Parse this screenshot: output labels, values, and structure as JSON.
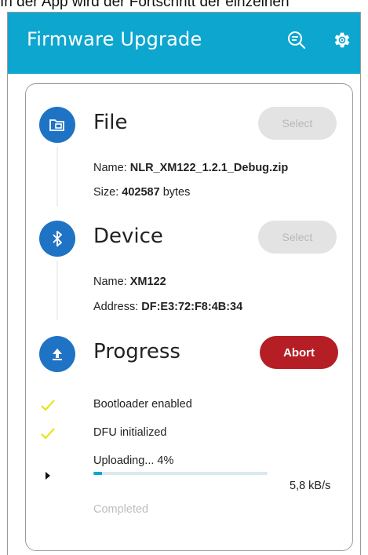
{
  "caption": "In der App wird der Fortschritt der einzelnen",
  "appbar": {
    "title": "Firmware Upgrade",
    "bg_color": "#0da6cf",
    "actions": [
      {
        "icon": "search-list-icon"
      },
      {
        "icon": "gear-icon"
      }
    ]
  },
  "sections": {
    "file": {
      "title": "File",
      "icon": "folder-icon",
      "button": "Select",
      "name_label": "Name:",
      "name_value": "NLR_XM122_1.2.1_Debug.zip",
      "size_label": "Size:",
      "size_value": "402587",
      "size_unit": "bytes"
    },
    "device": {
      "title": "Device",
      "icon": "bluetooth-icon",
      "button": "Select",
      "name_label": "Name:",
      "name_value": "XM122",
      "address_label": "Address:",
      "address_value": "DF:E3:72:F8:4B:34"
    },
    "progress": {
      "title": "Progress",
      "icon": "upload-icon",
      "abort_button": "Abort",
      "abort_color": "#b51e24",
      "steps": [
        {
          "label": "Bootloader enabled",
          "state": "done"
        },
        {
          "label": "DFU initialized",
          "state": "done"
        },
        {
          "label": "Uploading... 4%",
          "state": "active"
        },
        {
          "label": "Completed",
          "state": "pending"
        }
      ],
      "upload_fraction": 0.04,
      "speed": "5,8 kB/s"
    }
  },
  "colors": {
    "accent_blue": "#1f73c5",
    "check_yellow": "#e8e100",
    "progress_fill": "#0da6cf"
  }
}
